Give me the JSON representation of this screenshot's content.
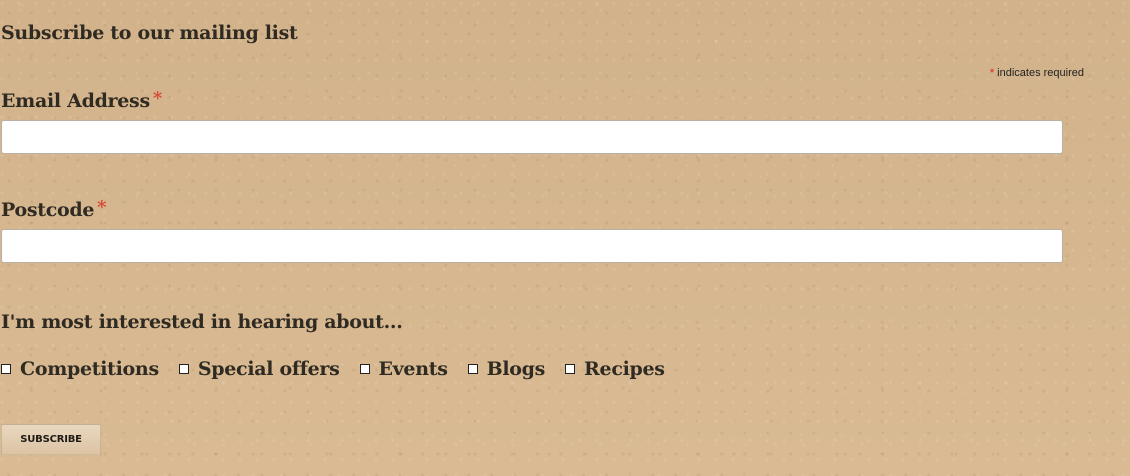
{
  "page": {
    "title": "Subscribe to our mailing list"
  },
  "form": {
    "required_note": {
      "asterisk": "*",
      "text": "indicates required"
    },
    "fields": {
      "email": {
        "label": "Email Address",
        "asterisk": "*",
        "value": "",
        "placeholder": ""
      },
      "postcode": {
        "label": "Postcode",
        "asterisk": "*",
        "value": "",
        "placeholder": ""
      }
    },
    "interests": {
      "heading": "I'm most interested in hearing about...",
      "options": [
        {
          "label": "Competitions",
          "checked": false
        },
        {
          "label": "Special offers",
          "checked": false
        },
        {
          "label": "Events",
          "checked": false
        },
        {
          "label": "Blogs",
          "checked": false
        },
        {
          "label": "Recipes",
          "checked": false
        }
      ]
    },
    "submit": {
      "label": "Subscribe"
    }
  },
  "colors": {
    "background": "#d8b88f",
    "text": "#2f2a22",
    "required": "#d84a3a",
    "input_bg": "#ffffff",
    "button_bg": "#e2ccb0"
  }
}
